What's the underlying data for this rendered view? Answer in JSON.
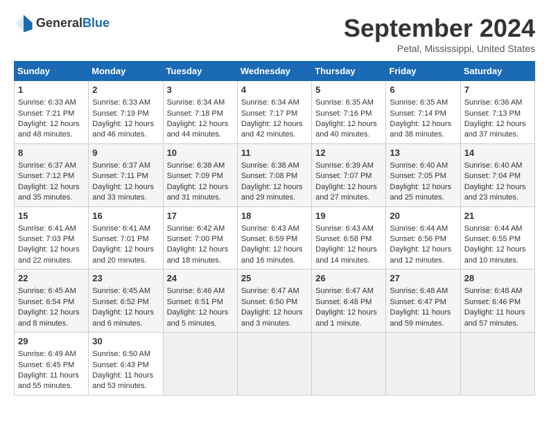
{
  "logo": {
    "text1": "General",
    "text2": "Blue"
  },
  "title": "September 2024",
  "location": "Petal, Mississippi, United States",
  "headers": [
    "Sunday",
    "Monday",
    "Tuesday",
    "Wednesday",
    "Thursday",
    "Friday",
    "Saturday"
  ],
  "weeks": [
    [
      {
        "day": "1",
        "line1": "Sunrise: 6:33 AM",
        "line2": "Sunset: 7:21 PM",
        "line3": "Daylight: 12 hours",
        "line4": "and 48 minutes."
      },
      {
        "day": "2",
        "line1": "Sunrise: 6:33 AM",
        "line2": "Sunset: 7:19 PM",
        "line3": "Daylight: 12 hours",
        "line4": "and 46 minutes."
      },
      {
        "day": "3",
        "line1": "Sunrise: 6:34 AM",
        "line2": "Sunset: 7:18 PM",
        "line3": "Daylight: 12 hours",
        "line4": "and 44 minutes."
      },
      {
        "day": "4",
        "line1": "Sunrise: 6:34 AM",
        "line2": "Sunset: 7:17 PM",
        "line3": "Daylight: 12 hours",
        "line4": "and 42 minutes."
      },
      {
        "day": "5",
        "line1": "Sunrise: 6:35 AM",
        "line2": "Sunset: 7:16 PM",
        "line3": "Daylight: 12 hours",
        "line4": "and 40 minutes."
      },
      {
        "day": "6",
        "line1": "Sunrise: 6:35 AM",
        "line2": "Sunset: 7:14 PM",
        "line3": "Daylight: 12 hours",
        "line4": "and 38 minutes."
      },
      {
        "day": "7",
        "line1": "Sunrise: 6:36 AM",
        "line2": "Sunset: 7:13 PM",
        "line3": "Daylight: 12 hours",
        "line4": "and 37 minutes."
      }
    ],
    [
      {
        "day": "8",
        "line1": "Sunrise: 6:37 AM",
        "line2": "Sunset: 7:12 PM",
        "line3": "Daylight: 12 hours",
        "line4": "and 35 minutes."
      },
      {
        "day": "9",
        "line1": "Sunrise: 6:37 AM",
        "line2": "Sunset: 7:11 PM",
        "line3": "Daylight: 12 hours",
        "line4": "and 33 minutes."
      },
      {
        "day": "10",
        "line1": "Sunrise: 6:38 AM",
        "line2": "Sunset: 7:09 PM",
        "line3": "Daylight: 12 hours",
        "line4": "and 31 minutes."
      },
      {
        "day": "11",
        "line1": "Sunrise: 6:38 AM",
        "line2": "Sunset: 7:08 PM",
        "line3": "Daylight: 12 hours",
        "line4": "and 29 minutes."
      },
      {
        "day": "12",
        "line1": "Sunrise: 6:39 AM",
        "line2": "Sunset: 7:07 PM",
        "line3": "Daylight: 12 hours",
        "line4": "and 27 minutes."
      },
      {
        "day": "13",
        "line1": "Sunrise: 6:40 AM",
        "line2": "Sunset: 7:05 PM",
        "line3": "Daylight: 12 hours",
        "line4": "and 25 minutes."
      },
      {
        "day": "14",
        "line1": "Sunrise: 6:40 AM",
        "line2": "Sunset: 7:04 PM",
        "line3": "Daylight: 12 hours",
        "line4": "and 23 minutes."
      }
    ],
    [
      {
        "day": "15",
        "line1": "Sunrise: 6:41 AM",
        "line2": "Sunset: 7:03 PM",
        "line3": "Daylight: 12 hours",
        "line4": "and 22 minutes."
      },
      {
        "day": "16",
        "line1": "Sunrise: 6:41 AM",
        "line2": "Sunset: 7:01 PM",
        "line3": "Daylight: 12 hours",
        "line4": "and 20 minutes."
      },
      {
        "day": "17",
        "line1": "Sunrise: 6:42 AM",
        "line2": "Sunset: 7:00 PM",
        "line3": "Daylight: 12 hours",
        "line4": "and 18 minutes."
      },
      {
        "day": "18",
        "line1": "Sunrise: 6:43 AM",
        "line2": "Sunset: 6:59 PM",
        "line3": "Daylight: 12 hours",
        "line4": "and 16 minutes."
      },
      {
        "day": "19",
        "line1": "Sunrise: 6:43 AM",
        "line2": "Sunset: 6:58 PM",
        "line3": "Daylight: 12 hours",
        "line4": "and 14 minutes."
      },
      {
        "day": "20",
        "line1": "Sunrise: 6:44 AM",
        "line2": "Sunset: 6:56 PM",
        "line3": "Daylight: 12 hours",
        "line4": "and 12 minutes."
      },
      {
        "day": "21",
        "line1": "Sunrise: 6:44 AM",
        "line2": "Sunset: 6:55 PM",
        "line3": "Daylight: 12 hours",
        "line4": "and 10 minutes."
      }
    ],
    [
      {
        "day": "22",
        "line1": "Sunrise: 6:45 AM",
        "line2": "Sunset: 6:54 PM",
        "line3": "Daylight: 12 hours",
        "line4": "and 8 minutes."
      },
      {
        "day": "23",
        "line1": "Sunrise: 6:45 AM",
        "line2": "Sunset: 6:52 PM",
        "line3": "Daylight: 12 hours",
        "line4": "and 6 minutes."
      },
      {
        "day": "24",
        "line1": "Sunrise: 6:46 AM",
        "line2": "Sunset: 6:51 PM",
        "line3": "Daylight: 12 hours",
        "line4": "and 5 minutes."
      },
      {
        "day": "25",
        "line1": "Sunrise: 6:47 AM",
        "line2": "Sunset: 6:50 PM",
        "line3": "Daylight: 12 hours",
        "line4": "and 3 minutes."
      },
      {
        "day": "26",
        "line1": "Sunrise: 6:47 AM",
        "line2": "Sunset: 6:48 PM",
        "line3": "Daylight: 12 hours",
        "line4": "and 1 minute."
      },
      {
        "day": "27",
        "line1": "Sunrise: 6:48 AM",
        "line2": "Sunset: 6:47 PM",
        "line3": "Daylight: 11 hours",
        "line4": "and 59 minutes."
      },
      {
        "day": "28",
        "line1": "Sunrise: 6:48 AM",
        "line2": "Sunset: 6:46 PM",
        "line3": "Daylight: 11 hours",
        "line4": "and 57 minutes."
      }
    ],
    [
      {
        "day": "29",
        "line1": "Sunrise: 6:49 AM",
        "line2": "Sunset: 6:45 PM",
        "line3": "Daylight: 11 hours",
        "line4": "and 55 minutes."
      },
      {
        "day": "30",
        "line1": "Sunrise: 6:50 AM",
        "line2": "Sunset: 6:43 PM",
        "line3": "Daylight: 11 hours",
        "line4": "and 53 minutes."
      },
      {
        "day": "",
        "line1": "",
        "line2": "",
        "line3": "",
        "line4": ""
      },
      {
        "day": "",
        "line1": "",
        "line2": "",
        "line3": "",
        "line4": ""
      },
      {
        "day": "",
        "line1": "",
        "line2": "",
        "line3": "",
        "line4": ""
      },
      {
        "day": "",
        "line1": "",
        "line2": "",
        "line3": "",
        "line4": ""
      },
      {
        "day": "",
        "line1": "",
        "line2": "",
        "line3": "",
        "line4": ""
      }
    ]
  ]
}
